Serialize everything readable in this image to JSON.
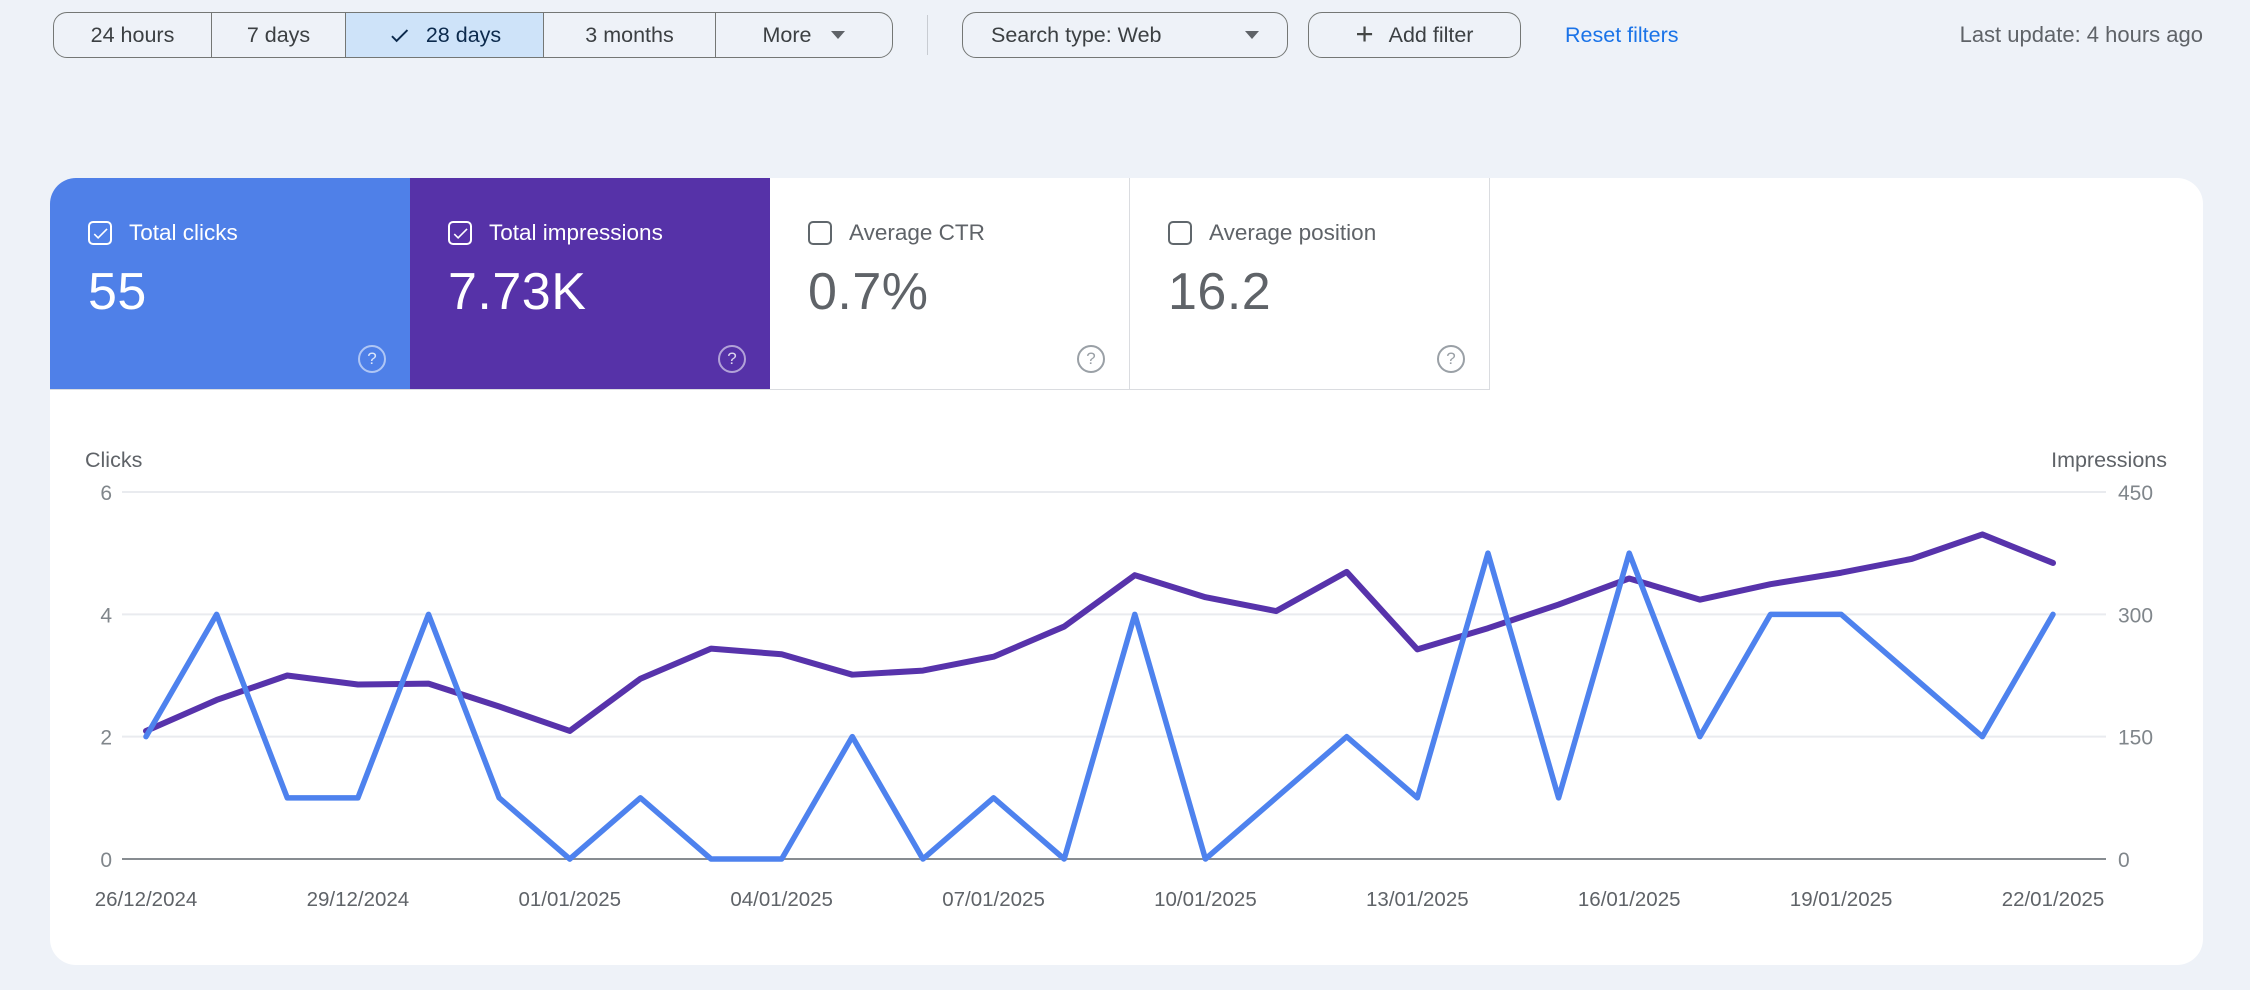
{
  "topbar": {
    "time_ranges": [
      {
        "label": "24 hours",
        "selected": false
      },
      {
        "label": "7 days",
        "selected": false
      },
      {
        "label": "28 days",
        "selected": true
      },
      {
        "label": "3 months",
        "selected": false
      }
    ],
    "more_label": "More",
    "search_type_label": "Search type: Web",
    "add_filter_label": "Add filter",
    "reset_filters_label": "Reset filters",
    "last_update": "Last update: 4 hours ago"
  },
  "icons": {
    "help_glyph": "?",
    "plus_glyph": "+"
  },
  "metrics": {
    "tiles": [
      {
        "label": "Total clicks",
        "value": "55",
        "selected": true,
        "color": "#4f80e8"
      },
      {
        "label": "Total impressions",
        "value": "7.73K",
        "selected": true,
        "color": "#5632a8"
      },
      {
        "label": "Average CTR",
        "value": "0.7%",
        "selected": false,
        "color": "#ffffff"
      },
      {
        "label": "Average position",
        "value": "16.2",
        "selected": false,
        "color": "#ffffff"
      }
    ]
  },
  "chart_data": {
    "type": "line",
    "x": [
      "26/12/2024",
      "27/12/2024",
      "28/12/2024",
      "29/12/2024",
      "30/12/2024",
      "31/12/2024",
      "01/01/2025",
      "02/01/2025",
      "03/01/2025",
      "04/01/2025",
      "05/01/2025",
      "06/01/2025",
      "07/01/2025",
      "08/01/2025",
      "09/01/2025",
      "10/01/2025",
      "11/01/2025",
      "12/01/2025",
      "13/01/2025",
      "14/01/2025",
      "15/01/2025",
      "16/01/2025",
      "17/01/2025",
      "18/01/2025",
      "19/01/2025",
      "20/01/2025",
      "21/01/2025",
      "22/01/2025"
    ],
    "x_tick_labels": [
      "26/12/2024",
      "29/12/2024",
      "01/01/2025",
      "04/01/2025",
      "07/01/2025",
      "10/01/2025",
      "13/01/2025",
      "16/01/2025",
      "19/01/2025",
      "22/01/2025"
    ],
    "x_tick_every": 3,
    "series": [
      {
        "name": "Clicks",
        "axis": "left",
        "color": "#4e82ee",
        "values": [
          2,
          4,
          1,
          1,
          4,
          1,
          0,
          1,
          0,
          0,
          2,
          0,
          1,
          0,
          4,
          0,
          1,
          2,
          1,
          5,
          1,
          5,
          2,
          4,
          4,
          3,
          2,
          4
        ]
      },
      {
        "name": "Impressions",
        "axis": "right",
        "color": "#5733ab",
        "values": [
          157,
          195,
          225,
          214,
          215,
          187,
          157,
          221,
          258,
          251,
          226,
          231,
          248,
          285,
          348,
          321,
          304,
          352,
          257,
          283,
          312,
          344,
          318,
          337,
          351,
          368,
          398,
          363
        ]
      }
    ],
    "left_axis": {
      "label": "Clicks",
      "ticks": [
        0,
        2,
        4,
        6
      ],
      "range": [
        0,
        6
      ]
    },
    "right_axis": {
      "label": "Impressions",
      "ticks": [
        0,
        150,
        300,
        450
      ],
      "range": [
        0,
        450
      ]
    },
    "grid": true,
    "legend_position": "none",
    "totals": {
      "clicks": "55",
      "impressions": "7.73K",
      "ctr": "0.7%",
      "position": "16.2"
    }
  },
  "colors": {
    "clicks_blue": "#4f80e8",
    "impressions_purple": "#5632a8",
    "clicks_line": "#4e82ee",
    "impressions_line": "#5733ab",
    "chip_selected_bg": "#cee3f9",
    "chip_selected_text": "#0c2a4d",
    "link_blue": "#1a73e8",
    "page_background": "#eef2f8"
  }
}
